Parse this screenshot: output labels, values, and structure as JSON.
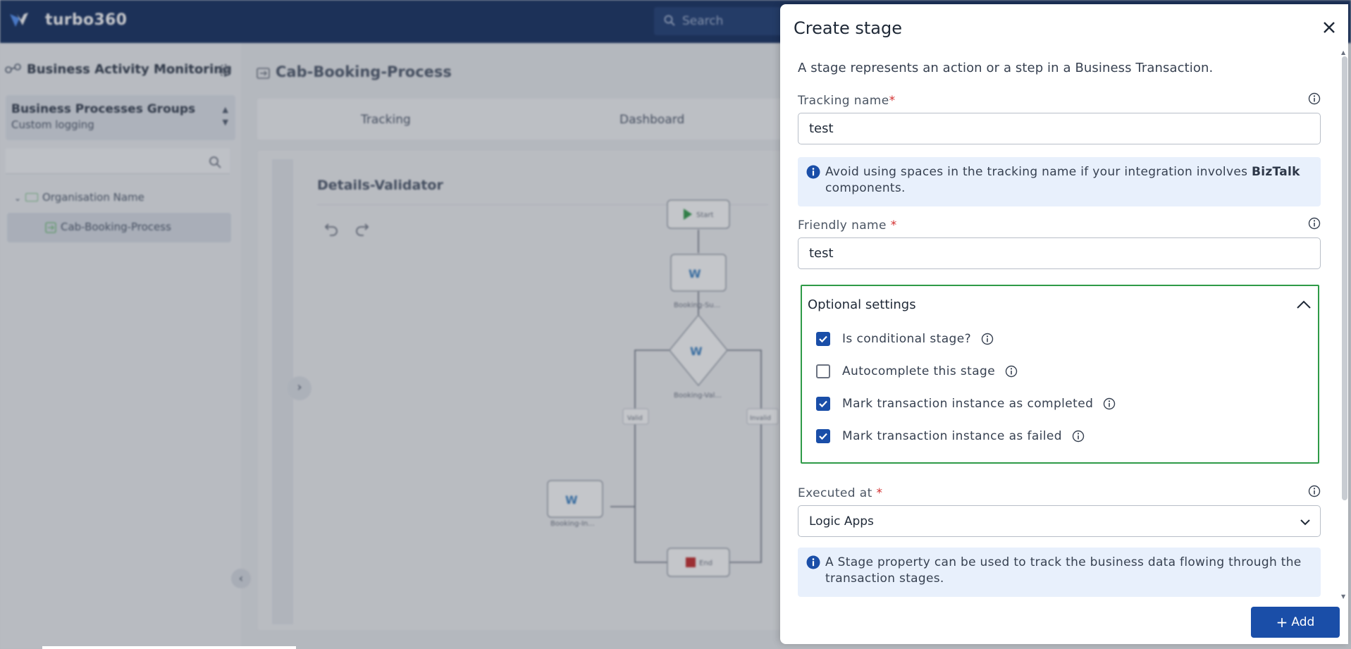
{
  "app": {
    "brand": "turbo360",
    "search_placeholder": "Search"
  },
  "sidebar": {
    "title": "Business Activity Monitoring",
    "group": {
      "title": "Business Processes Groups",
      "subtitle": "Custom logging"
    },
    "tree": {
      "org": "Organisation Name",
      "process": "Cab-Booking-Process"
    }
  },
  "main": {
    "title": "Cab-Booking-Process",
    "tabs": [
      "Tracking",
      "Dashboard"
    ],
    "canvas_title": "Details-Validator",
    "flow": {
      "start": "Start",
      "end": "End",
      "node_booking_su": "Booking-Su...",
      "node_booking_val": "Booking-Val...",
      "node_booking_in": "Booking-In...",
      "edge_valid": "Valid",
      "edge_invalid": "Invalid"
    }
  },
  "modal": {
    "title": "Create stage",
    "description": "A stage represents an action or a step in a Business Transaction.",
    "tracking_name": {
      "label": "Tracking name",
      "required_mark": "*",
      "value": "test"
    },
    "tracking_note": {
      "before": "Avoid using spaces in the tracking name if your integration involves ",
      "bold": "BizTalk",
      "after": " components."
    },
    "friendly_name": {
      "label": "Friendly name",
      "required_mark": "*",
      "value": "test"
    },
    "optional_settings": {
      "title": "Optional settings",
      "expanded": true,
      "options": [
        {
          "label": "Is conditional stage?",
          "checked": true
        },
        {
          "label": "Autocomplete this stage",
          "checked": false
        },
        {
          "label": "Mark transaction instance as completed",
          "checked": true
        },
        {
          "label": "Mark transaction instance as failed",
          "checked": true
        }
      ]
    },
    "executed_at": {
      "label": "Executed at",
      "required_mark": "*",
      "value": "Logic Apps"
    },
    "property_note": "A Stage property can be used to track the business data flowing through the transaction stages.",
    "add_button": {
      "icon": "+",
      "label": "Add"
    }
  },
  "colors": {
    "primary": "#1a4ea8",
    "topbar": "#0f2a5c",
    "highlight_border": "#2e9a47",
    "note_bg": "#e8f0fc",
    "required": "#d32f2f"
  },
  "icons": {
    "close": "close-icon",
    "info": "info-icon",
    "collapse": "chevron-up-icon",
    "dropdown": "chevron-down-icon",
    "check": "check-icon"
  }
}
